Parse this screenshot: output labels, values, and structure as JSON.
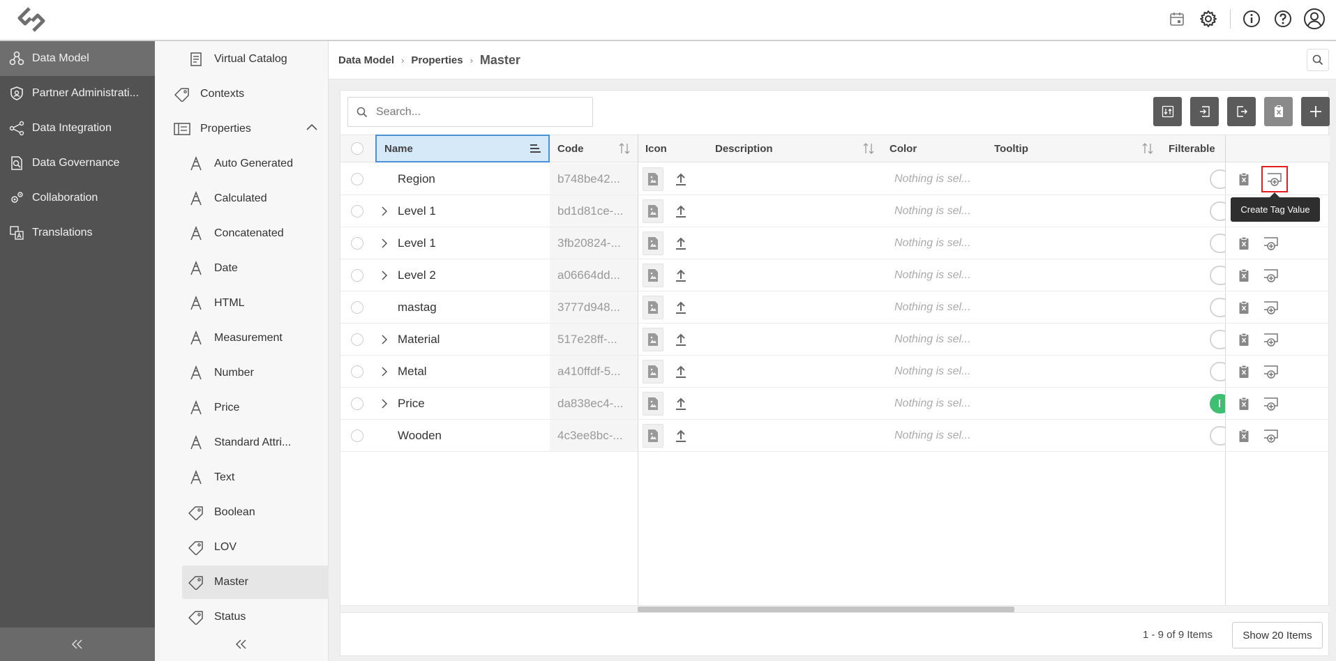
{
  "header": {
    "icons": [
      "logo-icon",
      "calendar-icon",
      "gear-icon",
      "info-icon",
      "help-icon",
      "user-icon"
    ]
  },
  "leftnav": {
    "items": [
      {
        "label": "Data Model",
        "icon": "data-model-icon",
        "active": true
      },
      {
        "label": "Partner Administrati...",
        "icon": "shield-icon",
        "active": false
      },
      {
        "label": "Data Integration",
        "icon": "integration-icon",
        "active": false
      },
      {
        "label": "Data Governance",
        "icon": "governance-icon",
        "active": false
      },
      {
        "label": "Collaboration",
        "icon": "collaboration-icon",
        "active": false
      },
      {
        "label": "Translations",
        "icon": "translation-icon",
        "active": false
      }
    ]
  },
  "subnav": {
    "virtual_catalog": "Virtual Catalog",
    "contexts": "Contexts",
    "properties": "Properties",
    "items": [
      {
        "label": "Auto Generated",
        "icon": "attribute-icon"
      },
      {
        "label": "Calculated",
        "icon": "attribute-icon"
      },
      {
        "label": "Concatenated",
        "icon": "attribute-icon"
      },
      {
        "label": "Date",
        "icon": "attribute-icon"
      },
      {
        "label": "HTML",
        "icon": "attribute-icon"
      },
      {
        "label": "Measurement",
        "icon": "attribute-icon"
      },
      {
        "label": "Number",
        "icon": "attribute-icon"
      },
      {
        "label": "Price",
        "icon": "attribute-icon"
      },
      {
        "label": "Standard Attri...",
        "icon": "attribute-icon"
      },
      {
        "label": "Text",
        "icon": "attribute-icon"
      },
      {
        "label": "Boolean",
        "icon": "tag-icon"
      },
      {
        "label": "LOV",
        "icon": "tag-icon"
      },
      {
        "label": "Master",
        "icon": "tag-icon"
      },
      {
        "label": "Status",
        "icon": "tag-icon"
      }
    ]
  },
  "breadcrumb": {
    "items": [
      "Data Model",
      "Properties"
    ],
    "current": "Master"
  },
  "search": {
    "placeholder": "Search..."
  },
  "columns": {
    "name": "Name",
    "code": "Code",
    "icon": "Icon",
    "description": "Description",
    "color": "Color",
    "tooltip": "Tooltip",
    "filterable": "Filterable"
  },
  "rows": [
    {
      "name": "Region",
      "expandable": false,
      "code": "b748be42...",
      "color": "Nothing is sel...",
      "filterable": false
    },
    {
      "name": "Level 1",
      "expandable": true,
      "code": "bd1d81ce-...",
      "color": "Nothing is sel...",
      "filterable": false
    },
    {
      "name": "Level 1",
      "expandable": true,
      "code": "3fb20824-...",
      "color": "Nothing is sel...",
      "filterable": false
    },
    {
      "name": "Level 2",
      "expandable": true,
      "code": "a06664dd...",
      "color": "Nothing is sel...",
      "filterable": false
    },
    {
      "name": "mastag",
      "expandable": false,
      "code": "3777d948...",
      "color": "Nothing is sel...",
      "filterable": false
    },
    {
      "name": "Material",
      "expandable": true,
      "code": "517e28ff-...",
      "color": "Nothing is sel...",
      "filterable": false
    },
    {
      "name": "Metal",
      "expandable": true,
      "code": "a410ffdf-5...",
      "color": "Nothing is sel...",
      "filterable": false
    },
    {
      "name": "Price",
      "expandable": true,
      "code": "da838ec4-...",
      "color": "Nothing is sel...",
      "filterable": true
    },
    {
      "name": "Wooden",
      "expandable": false,
      "code": "4c3ee8bc-...",
      "color": "Nothing is sel...",
      "filterable": false
    }
  ],
  "tooltip": {
    "text": "Create Tag Value"
  },
  "pager": {
    "info": "1 - 9 of 9 Items",
    "button": "Show 20 Items"
  },
  "colors": {
    "nav_bg": "#525252",
    "nav_active": "#6e6e6e",
    "toolbar_btn": "#5b5b5b",
    "toggle_on": "#3fbf72",
    "highlight": "#e31c1c",
    "name_header": "#d6e9f8"
  }
}
